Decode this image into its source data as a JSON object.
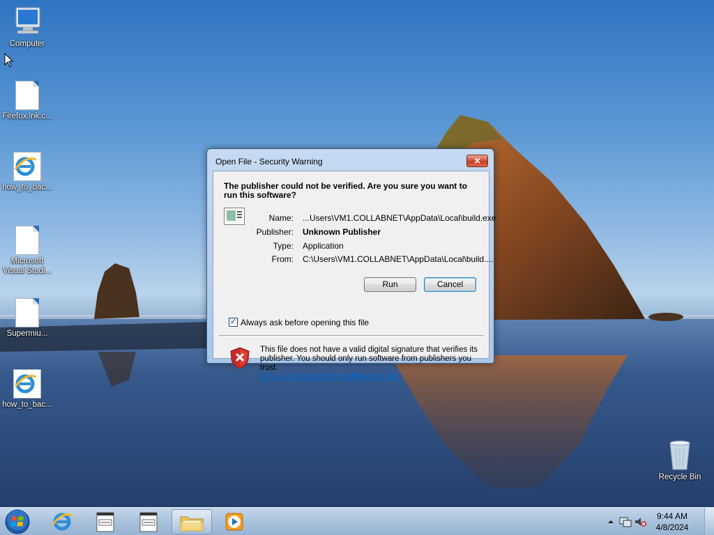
{
  "desktop": {
    "icons": [
      {
        "label": "Computer",
        "icon": "computer-icon"
      },
      {
        "label": "Firefox.lnk.c...",
        "icon": "document-icon"
      },
      {
        "label": "how_to_bac...",
        "icon": "ie-document-icon"
      },
      {
        "label": "Microsoft Visual Studi...",
        "icon": "document-icon"
      },
      {
        "label": "Supermiu...",
        "icon": "document-icon"
      },
      {
        "label": "how_to_bac...",
        "icon": "ie-document-icon"
      },
      {
        "label": "Recycle Bin",
        "icon": "recycle-bin-icon"
      }
    ]
  },
  "dialog": {
    "title": "Open File - Security Warning",
    "close_label": "✕",
    "headline": "The publisher could not be verified.  Are you sure you want to run this software?",
    "fields": {
      "name_label": "Name:",
      "name_value": "...Users\\VM1.COLLABNET\\AppData\\Local\\build.exe",
      "publisher_label": "Publisher:",
      "publisher_value": "Unknown Publisher",
      "type_label": "Type:",
      "type_value": "Application",
      "from_label": "From:",
      "from_value": "C:\\Users\\VM1.COLLABNET\\AppData\\Local\\build...."
    },
    "run_label": "Run",
    "cancel_label": "Cancel",
    "checkbox_label": "Always ask before opening this file",
    "checkbox_checked": true,
    "warning_text": "This file does not have a valid digital signature that verifies its publisher.  You should only run software from publishers you trust.",
    "warning_link": "How can I decide what software to run?"
  },
  "taskbar": {
    "pinned": [
      {
        "icon": "internet-explorer-icon"
      },
      {
        "icon": "notepad-icon"
      },
      {
        "icon": "notepad-icon"
      },
      {
        "icon": "folder-icon",
        "active": true
      },
      {
        "icon": "media-player-icon"
      }
    ],
    "clock_time": "9:44 AM",
    "clock_date": "4/8/2024"
  },
  "colors": {
    "accent": "#3c7fb1",
    "link": "#0066cc",
    "shield_red": "#c62828"
  }
}
